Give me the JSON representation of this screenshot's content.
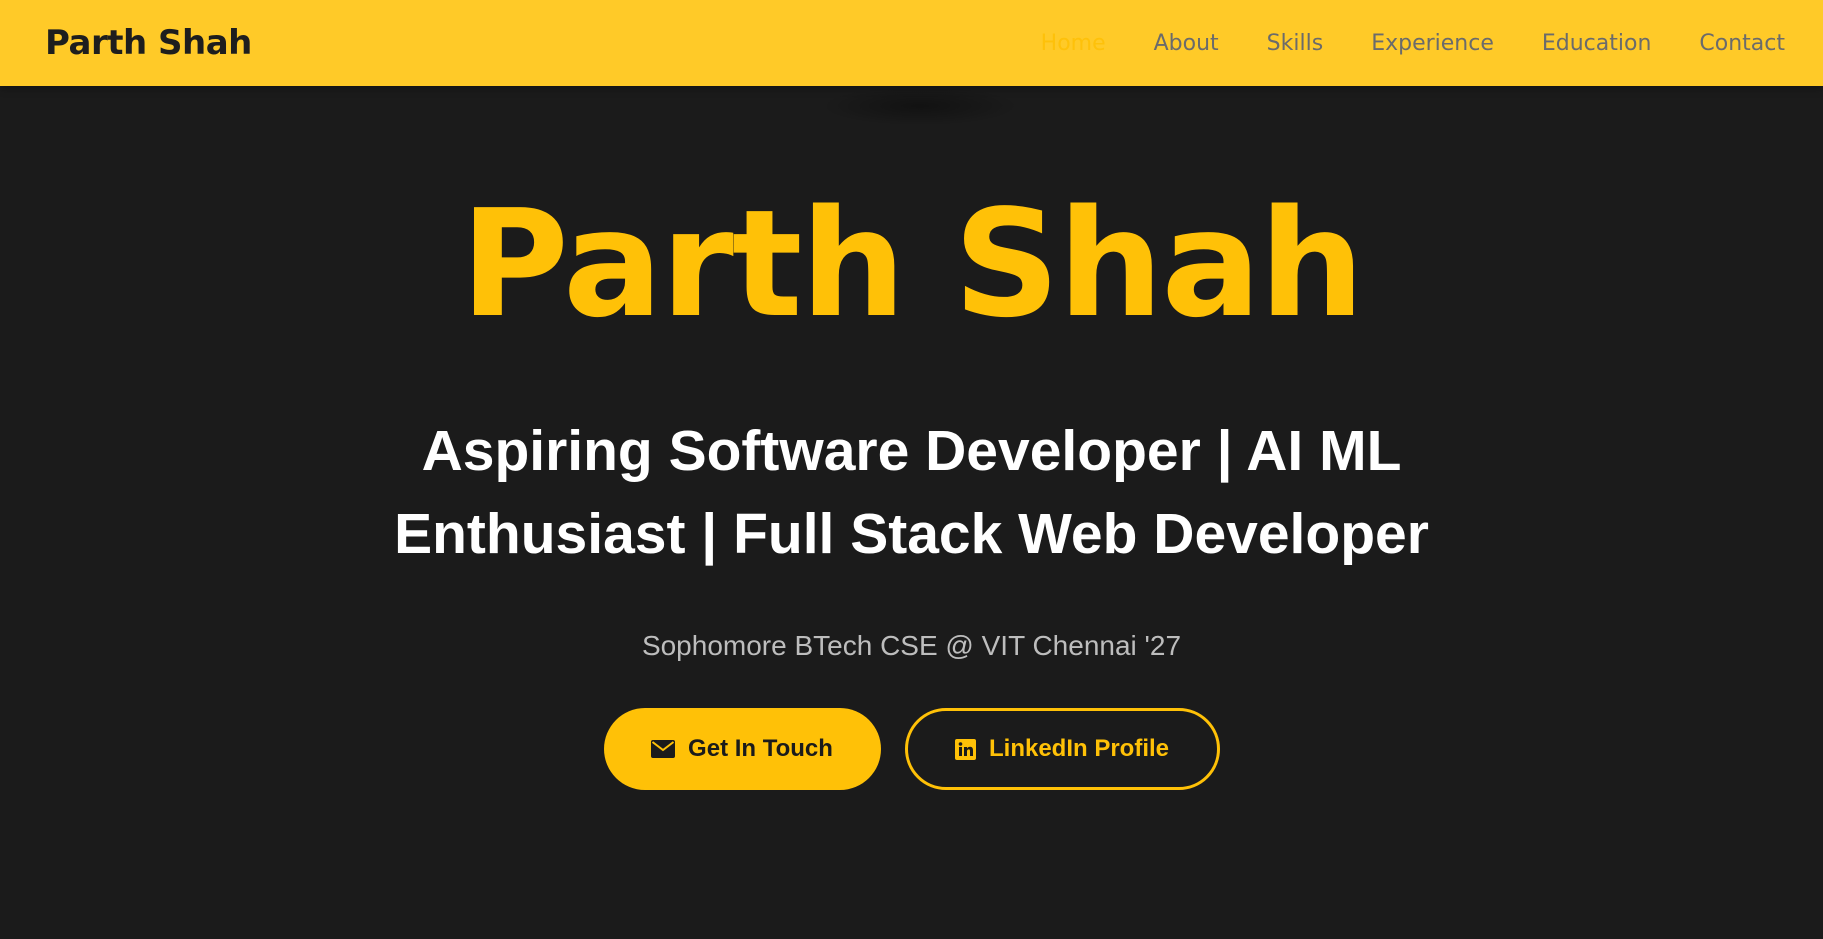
{
  "header": {
    "brand": "Parth Shah",
    "nav": [
      {
        "label": "Home",
        "active": true
      },
      {
        "label": "About",
        "active": false
      },
      {
        "label": "Skills",
        "active": false
      },
      {
        "label": "Experience",
        "active": false
      },
      {
        "label": "Education",
        "active": false
      },
      {
        "label": "Contact",
        "active": false
      }
    ]
  },
  "hero": {
    "name": "Parth Shah",
    "tagline": "Aspiring Software Developer | AI ML Enthusiast | Full Stack Web Developer",
    "subtitle": "Sophomore BTech CSE @ VIT Chennai '27",
    "buttons": {
      "contact_label": "Get In Touch",
      "contact_icon": "envelope-icon",
      "linkedin_label": "LinkedIn Profile",
      "linkedin_icon": "linkedin-icon"
    }
  },
  "colors": {
    "navbar_bg": "#ffca28",
    "accent": "#ffc107",
    "page_bg": "#1b1b1b",
    "nav_text": "#6b6b6b",
    "subtitle_text": "#bdbdbd"
  }
}
